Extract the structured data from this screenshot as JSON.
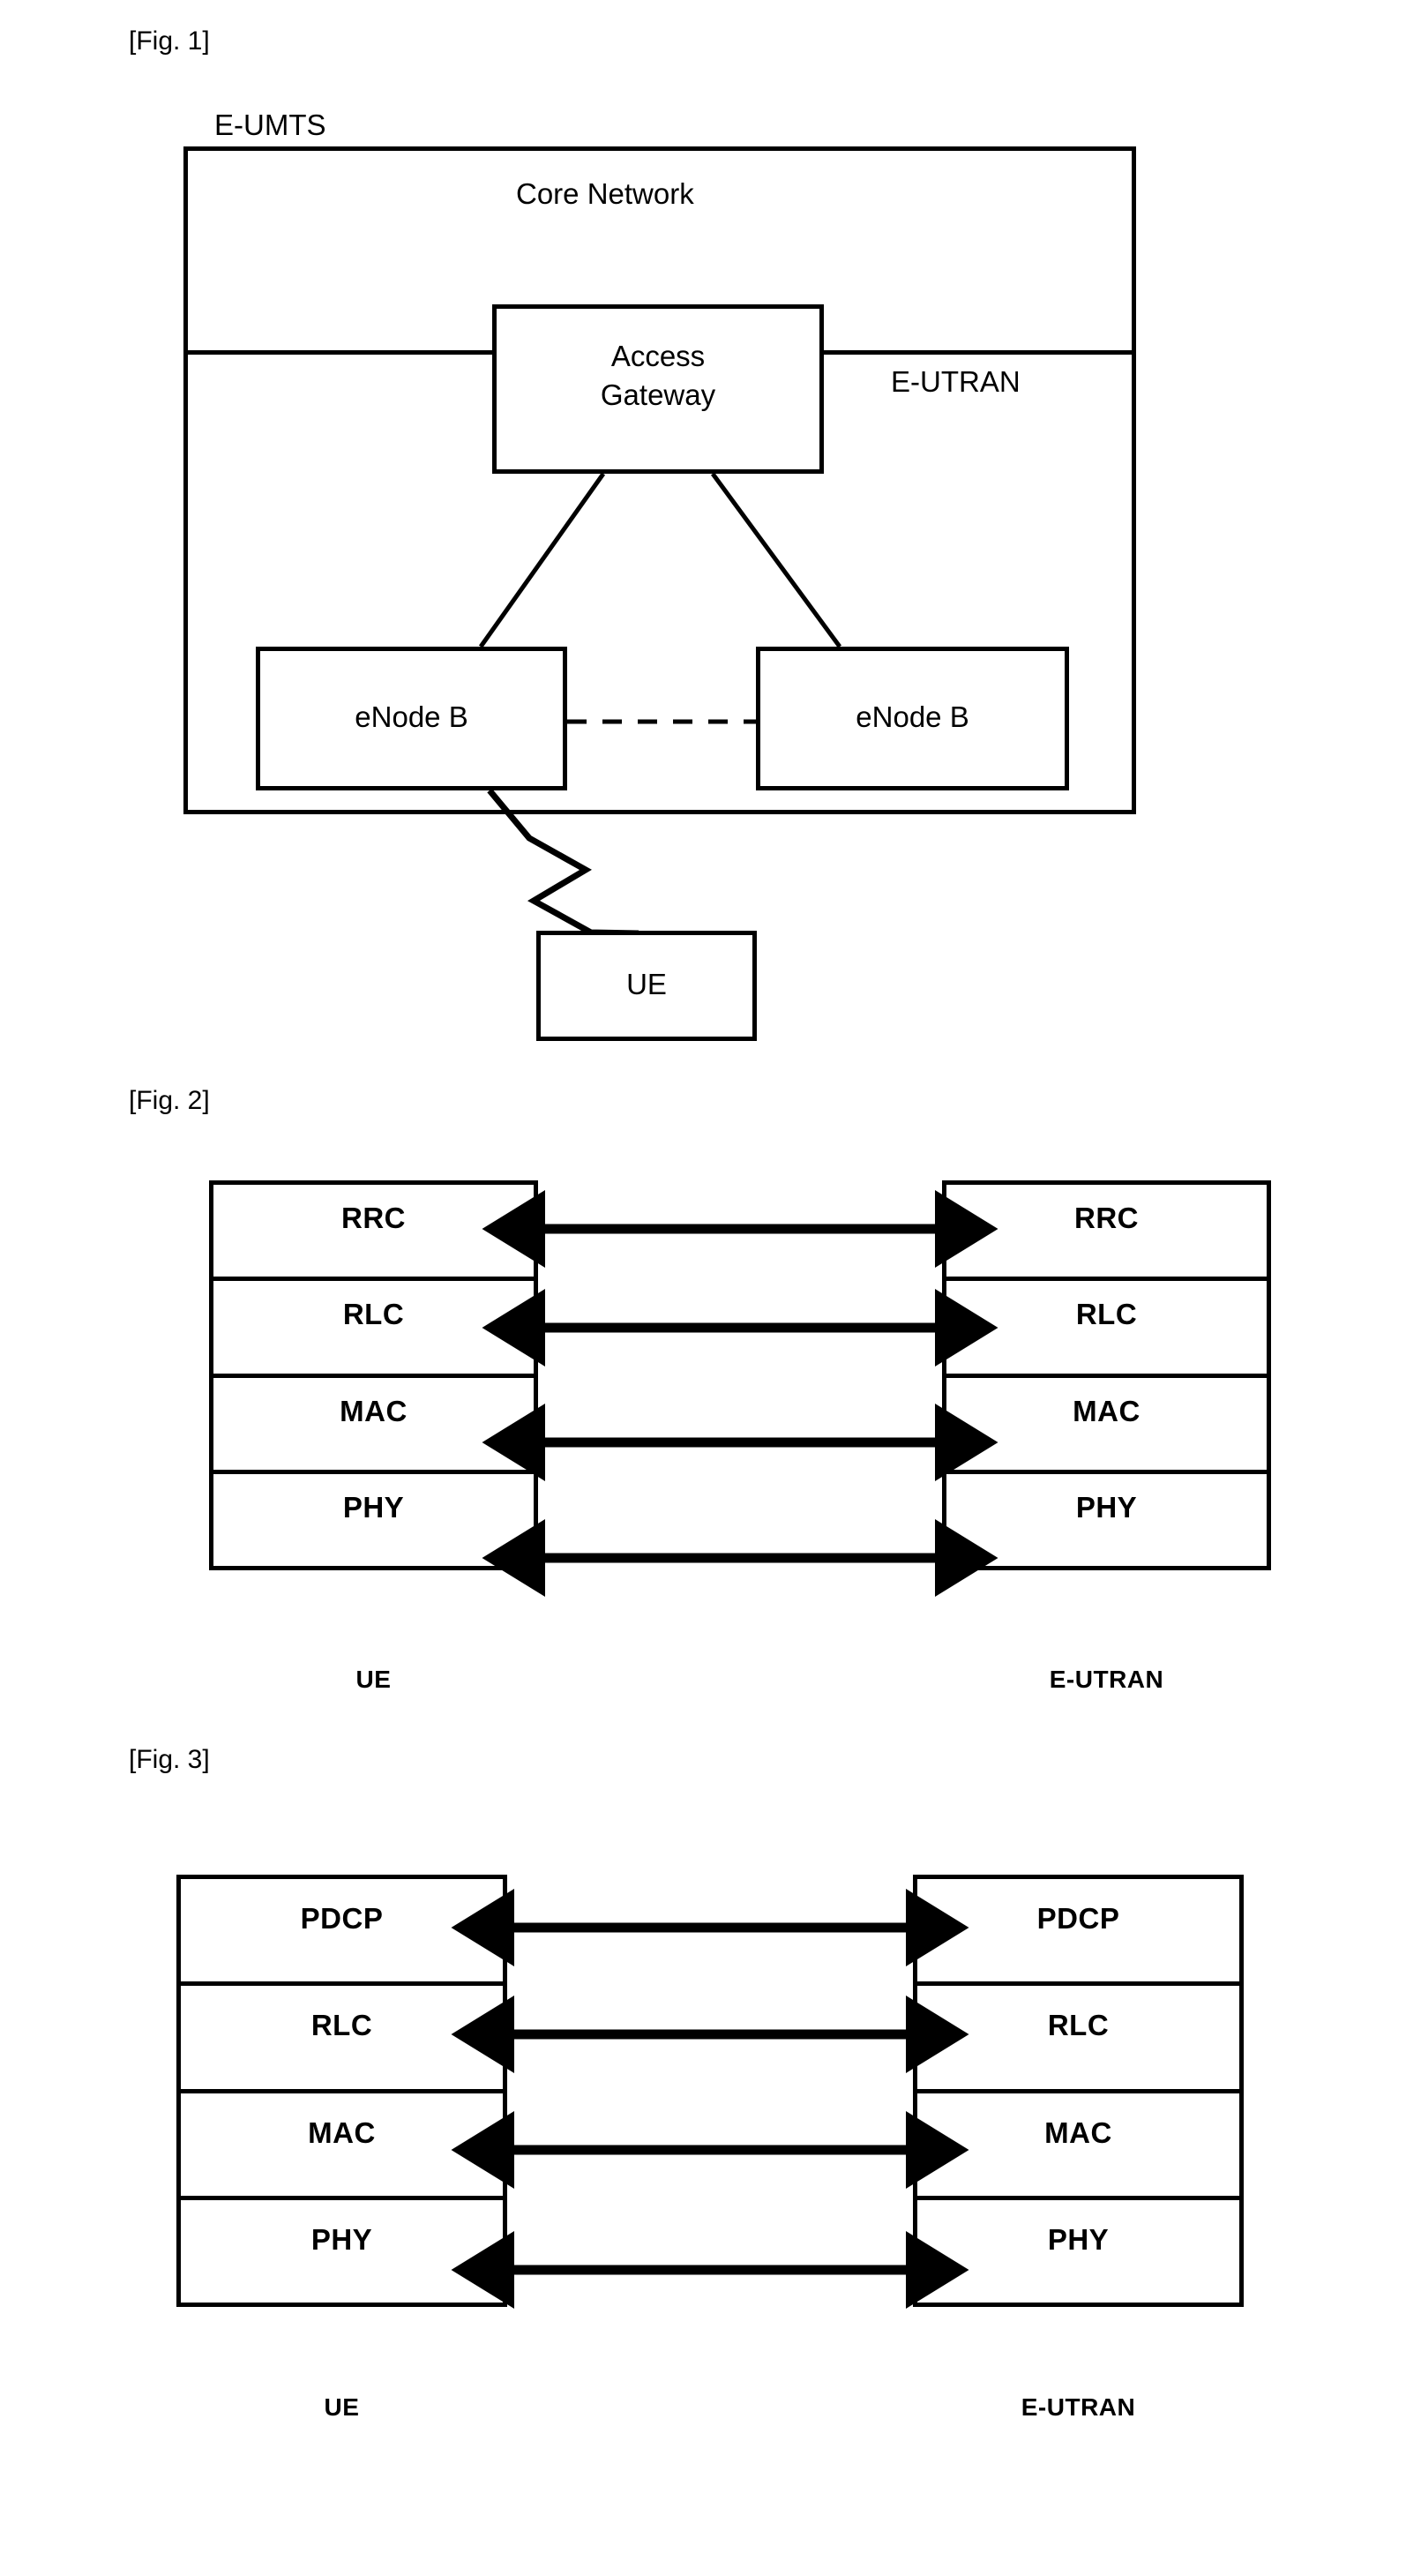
{
  "figures": [
    {
      "caption": "[Fig. 1]",
      "system_label": "E-UMTS",
      "core_network_label": "Core Network",
      "eutran_label": "E-UTRAN",
      "access_gateway_label_line1": "Access",
      "access_gateway_label_line2": "Gateway",
      "enodeb_left_label": "eNode B",
      "enodeb_right_label": "eNode B",
      "ue_label": "UE"
    },
    {
      "caption": "[Fig. 2]",
      "left_layers": [
        "RRC",
        "RLC",
        "MAC",
        "PHY"
      ],
      "right_layers": [
        "RRC",
        "RLC",
        "MAC",
        "PHY"
      ],
      "left_endpoint": "UE",
      "right_endpoint": "E-UTRAN"
    },
    {
      "caption": "[Fig. 3]",
      "left_layers": [
        "PDCP",
        "RLC",
        "MAC",
        "PHY"
      ],
      "right_layers": [
        "PDCP",
        "RLC",
        "MAC",
        "PHY"
      ],
      "left_endpoint": "UE",
      "right_endpoint": "E-UTRAN"
    }
  ],
  "colors": {
    "ink": "#000000",
    "paper": "#ffffff"
  }
}
